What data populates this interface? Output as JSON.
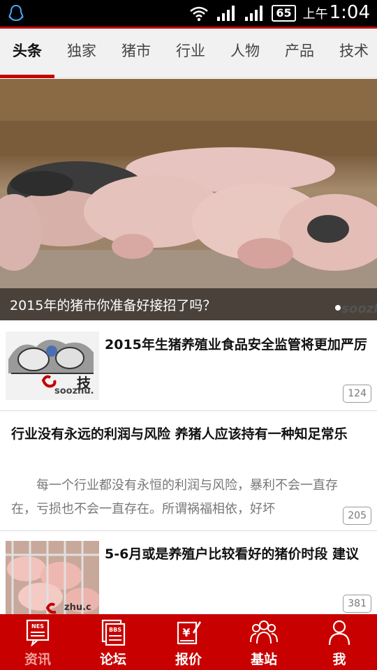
{
  "status_bar": {
    "battery": "65",
    "ampm": "上午",
    "time": "1:04"
  },
  "tabs": [
    {
      "label": "头条",
      "active": true
    },
    {
      "label": "独家",
      "active": false
    },
    {
      "label": "猪市",
      "active": false
    },
    {
      "label": "行业",
      "active": false
    },
    {
      "label": "人物",
      "active": false
    },
    {
      "label": "产品",
      "active": false
    },
    {
      "label": "技术",
      "active": false
    }
  ],
  "hero": {
    "caption": "2015年的猪市你准备好接招了吗？",
    "watermark": "soozh"
  },
  "news": [
    {
      "title": "2015年生猪养殖业食品安全监管将更加严厉",
      "count": "124",
      "thumb_text": "技",
      "thumb_watermark": "soozhu."
    },
    {
      "title": "行业没有永远的利润与风险 养猪人应该持有一种知足常乐",
      "summary": "每一个行业都没有永恒的利润与风险，暴利不会一直存在，亏损也不会一直存在。所谓祸福相依，好坏",
      "count": "205"
    },
    {
      "title": "5-6月或是养殖户比较看好的猪价时段 建议",
      "count": "381",
      "thumb_watermark": "zhu.c"
    }
  ],
  "bottom_nav": [
    {
      "label": "资讯",
      "icon": "news-icon",
      "icon_text": "NES",
      "active": true
    },
    {
      "label": "论坛",
      "icon": "forum-icon",
      "icon_text": "BBS",
      "active": false
    },
    {
      "label": "报价",
      "icon": "price-icon",
      "icon_text": "¥",
      "active": false
    },
    {
      "label": "基站",
      "icon": "base-station-icon",
      "active": false
    },
    {
      "label": "我",
      "icon": "profile-icon",
      "active": false
    }
  ],
  "colors": {
    "brand_red": "#c80000",
    "tab_indicator": "#c40000"
  }
}
